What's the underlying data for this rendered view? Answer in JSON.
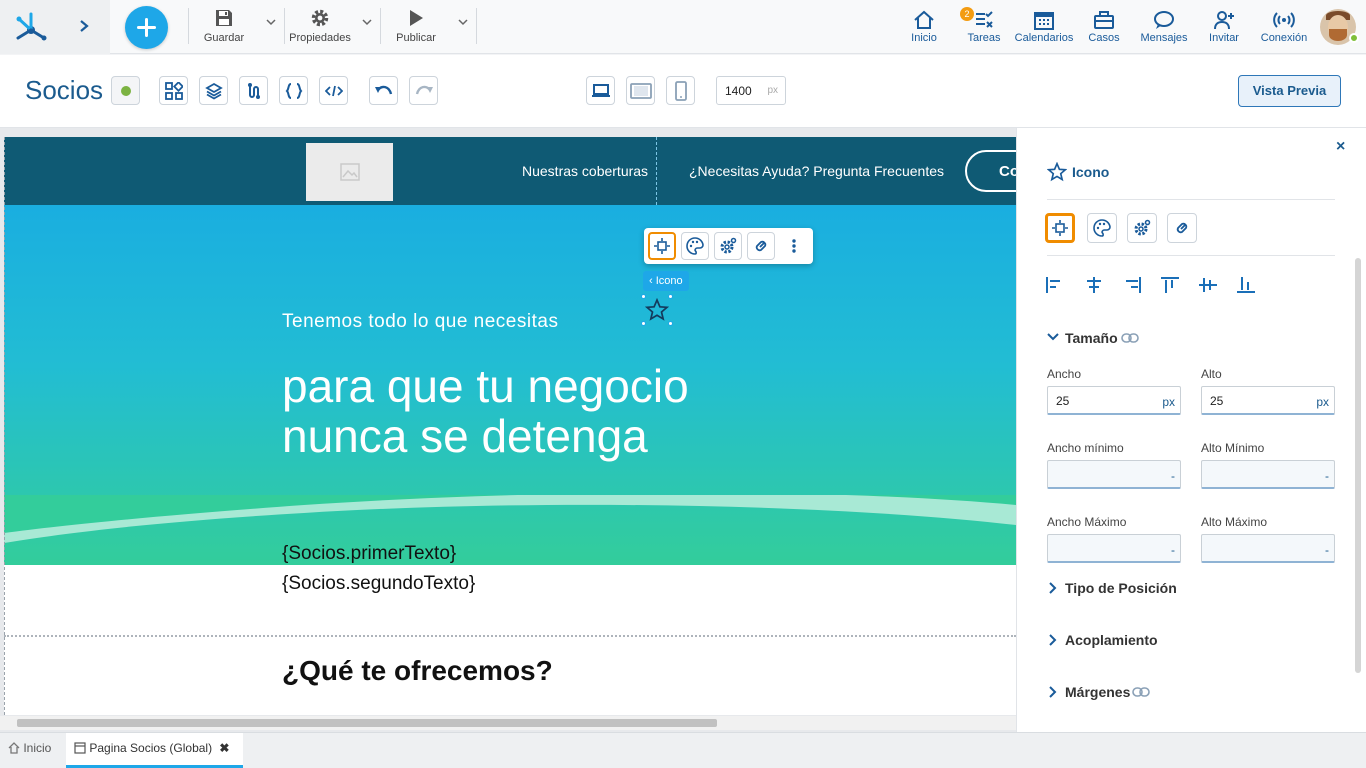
{
  "topbar": {
    "tools": [
      {
        "label": "Guardar",
        "icon": "save-icon"
      },
      {
        "label": "Propiedades",
        "icon": "gear-icon"
      },
      {
        "label": "Publicar",
        "icon": "play-icon"
      }
    ],
    "nav": [
      {
        "label": "Inicio",
        "icon": "home-icon"
      },
      {
        "label": "Tareas",
        "icon": "tasks-icon",
        "badge": "2"
      },
      {
        "label": "Calendarios",
        "icon": "calendar-icon"
      },
      {
        "label": "Casos",
        "icon": "briefcase-icon"
      },
      {
        "label": "Mensajes",
        "icon": "chat-icon"
      },
      {
        "label": "Invitar",
        "icon": "add-user-icon"
      },
      {
        "label": "Conexión",
        "icon": "signal-icon"
      }
    ]
  },
  "subbar": {
    "title": "Socios",
    "width_value": "1400",
    "width_unit": "px",
    "preview_label": "Vista Previa"
  },
  "canvas": {
    "nav_links": [
      "Nuestras coberturas",
      "¿Necesitas Ayuda? Pregunta Frecuentes"
    ],
    "contact_label": "Co",
    "hero_subtitle": "Tenemos todo lo que necesitas",
    "hero_title": "para que tu negocio nunca se detenga",
    "template_text_1": "{Socios.primerTexto}",
    "template_text_2": "{Socios.segundoTexto}",
    "offer_title": "¿Qué te ofrecemos?",
    "element_tag": "‹ Icono"
  },
  "panel": {
    "title": "Icono",
    "size_section": "Tamaño",
    "fields": {
      "width_label": "Ancho",
      "width_value": "25",
      "height_label": "Alto",
      "height_value": "25",
      "unit": "px",
      "min_width_label": "Ancho mínimo",
      "min_height_label": "Alto Mínimo",
      "max_width_label": "Ancho Máximo",
      "max_height_label": "Alto Máximo",
      "empty_value": "-"
    },
    "sections": [
      "Tipo de Posición",
      "Acoplamiento",
      "Márgenes"
    ]
  },
  "bottom_tabs": [
    {
      "label": "Inicio"
    },
    {
      "label": "Pagina Socios (Global)"
    }
  ],
  "colors": {
    "accent": "#1ea7e8",
    "header_dark": "#0f5a74",
    "active_outline": "#f08c00",
    "brand_text": "#1b5b8e"
  }
}
